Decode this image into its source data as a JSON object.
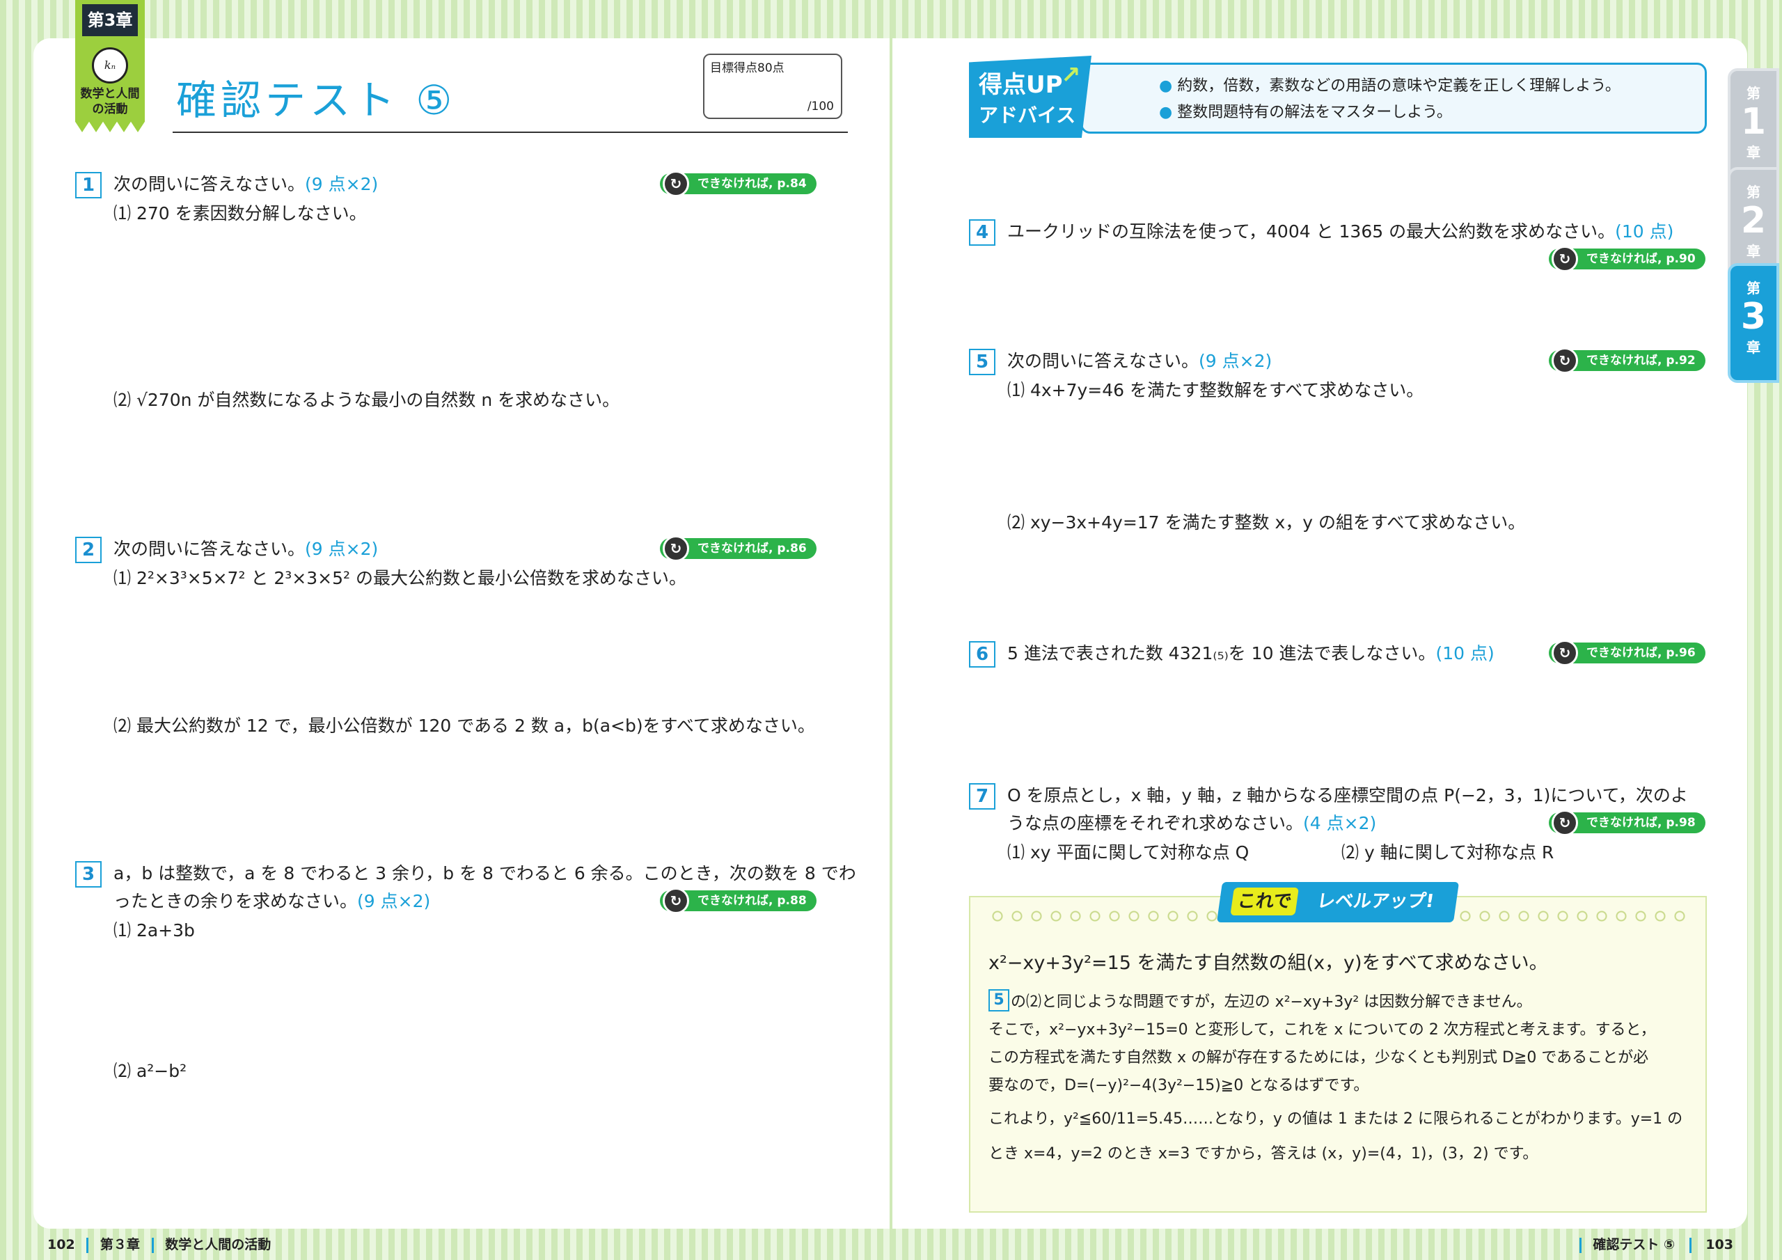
{
  "left_page": {
    "chapter_label": "第3章",
    "chapter_title": "数学と人間の活動",
    "page_title": "確認テスト ⑤",
    "score_box": {
      "target": "目標得点80点",
      "total": "/100"
    },
    "questions": [
      {
        "num": "1",
        "text": "次の問いに答えなさい。",
        "points": "(9 点×2)",
        "ref": "できなければ, p.84",
        "subs": [
          "⑴ 270 を素因数分解しなさい。",
          "⑵ √270n が自然数になるような最小の自然数 n を求めなさい。"
        ]
      },
      {
        "num": "2",
        "text": "次の問いに答えなさい。",
        "points": "(9 点×2)",
        "ref": "できなければ, p.86",
        "subs": [
          "⑴ 2²×3³×5×7² と 2³×3×5² の最大公約数と最小公倍数を求めなさい。",
          "⑵ 最大公約数が 12 で，最小公倍数が 120 である 2 数 a，b(a<b)をすべて求めなさい。"
        ]
      },
      {
        "num": "3",
        "text_line1": "a，b は整数で，a を 8 でわると 3 余り，b を 8 でわると 6 余る。このとき，次の数を 8 でわ",
        "text_line2": "ったときの余りを求めなさい。",
        "points": "(9 点×2)",
        "ref": "できなければ, p.88",
        "subs": [
          "⑴ 2a+3b",
          "⑵ a²−b²"
        ]
      }
    ],
    "footer": {
      "page_num": "102",
      "chapter": "第３章",
      "title": "数学と人間の活動"
    }
  },
  "right_page": {
    "advice": {
      "title1": "得点UP",
      "title2": "アドバイス",
      "items": [
        "約数，倍数，素数などの用語の意味や定義を正しく理解しよう。",
        "整数問題特有の解法をマスターしよう。"
      ]
    },
    "questions": [
      {
        "num": "4",
        "text": "ユークリッドの互除法を使って，4004 と 1365 の最大公約数を求めなさい。",
        "points": "(10 点)",
        "ref": "できなければ, p.90"
      },
      {
        "num": "5",
        "text": "次の問いに答えなさい。",
        "points": "(9 点×2)",
        "ref": "できなければ, p.92",
        "subs": [
          "⑴ 4x+7y=46 を満たす整数解をすべて求めなさい。",
          "⑵ xy−3x+4y=17 を満たす整数 x，y の組をすべて求めなさい。"
        ]
      },
      {
        "num": "6",
        "text": "5 進法で表された数 4321₍₅₎を 10 進法で表しなさい。",
        "points": "(10 点)",
        "ref": "できなければ, p.96"
      },
      {
        "num": "7",
        "text_line1": "O を原点とし，x 軸，y 軸，z 軸からなる座標空間の点 P(−2，3，1)について，次のよ",
        "text_line2": "うな点の座標をそれぞれ求めなさい。",
        "points": "(4 点×2)",
        "ref": "できなければ, p.98",
        "subs": [
          "⑴ xy 平面に関して対称な点 Q",
          "⑵ y 軸に関して対称な点 R"
        ]
      }
    ],
    "levelup": {
      "badge1": "これで",
      "badge2": "レベルアップ!",
      "problem": "x²−xy+3y²=15 を満たす自然数の組(x，y)をすべて求めなさい。",
      "ref_num": "5",
      "lines": [
        "の⑵と同じような問題ですが，左辺の x²−xy+3y² は因数分解できません。",
        "そこで，x²−yx+3y²−15=0 と変形して，これを x についての 2 次方程式と考えます。すると，",
        "この方程式を満たす自然数 x の解が存在するためには，少なくとも判別式 D≧0 であることが必",
        "要なので，D=(−y)²−4(3y²−15)≧0 となるはずです。",
        "これより，y²≦60/11=5.45……となり，y の値は 1 または 2 に限られることがわかります。y=1 の",
        "とき x=4，y=2 のとき x=3 ですから，答えは (x，y)=(4，1)，(3，2) です。"
      ]
    },
    "footer": {
      "title": "確認テスト ⑤",
      "page_num": "103"
    }
  },
  "tabs": [
    {
      "small": "第",
      "num": "1",
      "small2": "章"
    },
    {
      "small": "第",
      "num": "2",
      "small2": "章"
    },
    {
      "small": "第",
      "num": "3",
      "small2": "章"
    }
  ],
  "colors": {
    "accent_blue": "#1aa0d8",
    "green": "#2cb34a",
    "lime": "#9ccf3e"
  }
}
